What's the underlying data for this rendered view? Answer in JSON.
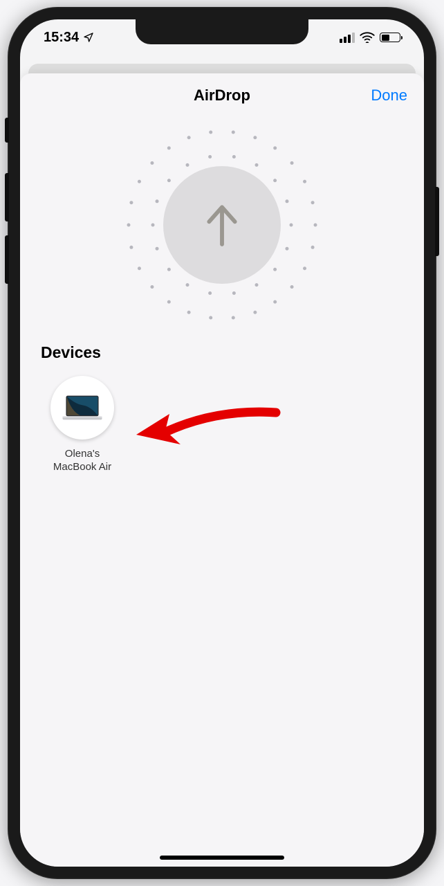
{
  "status": {
    "time": "15:34",
    "battery_pct": 40
  },
  "sheet": {
    "title": "AirDrop",
    "done": "Done"
  },
  "sections": {
    "devices_title": "Devices"
  },
  "devices": [
    {
      "name": "Olena's\nMacBook Air",
      "type": "macbook"
    }
  ]
}
